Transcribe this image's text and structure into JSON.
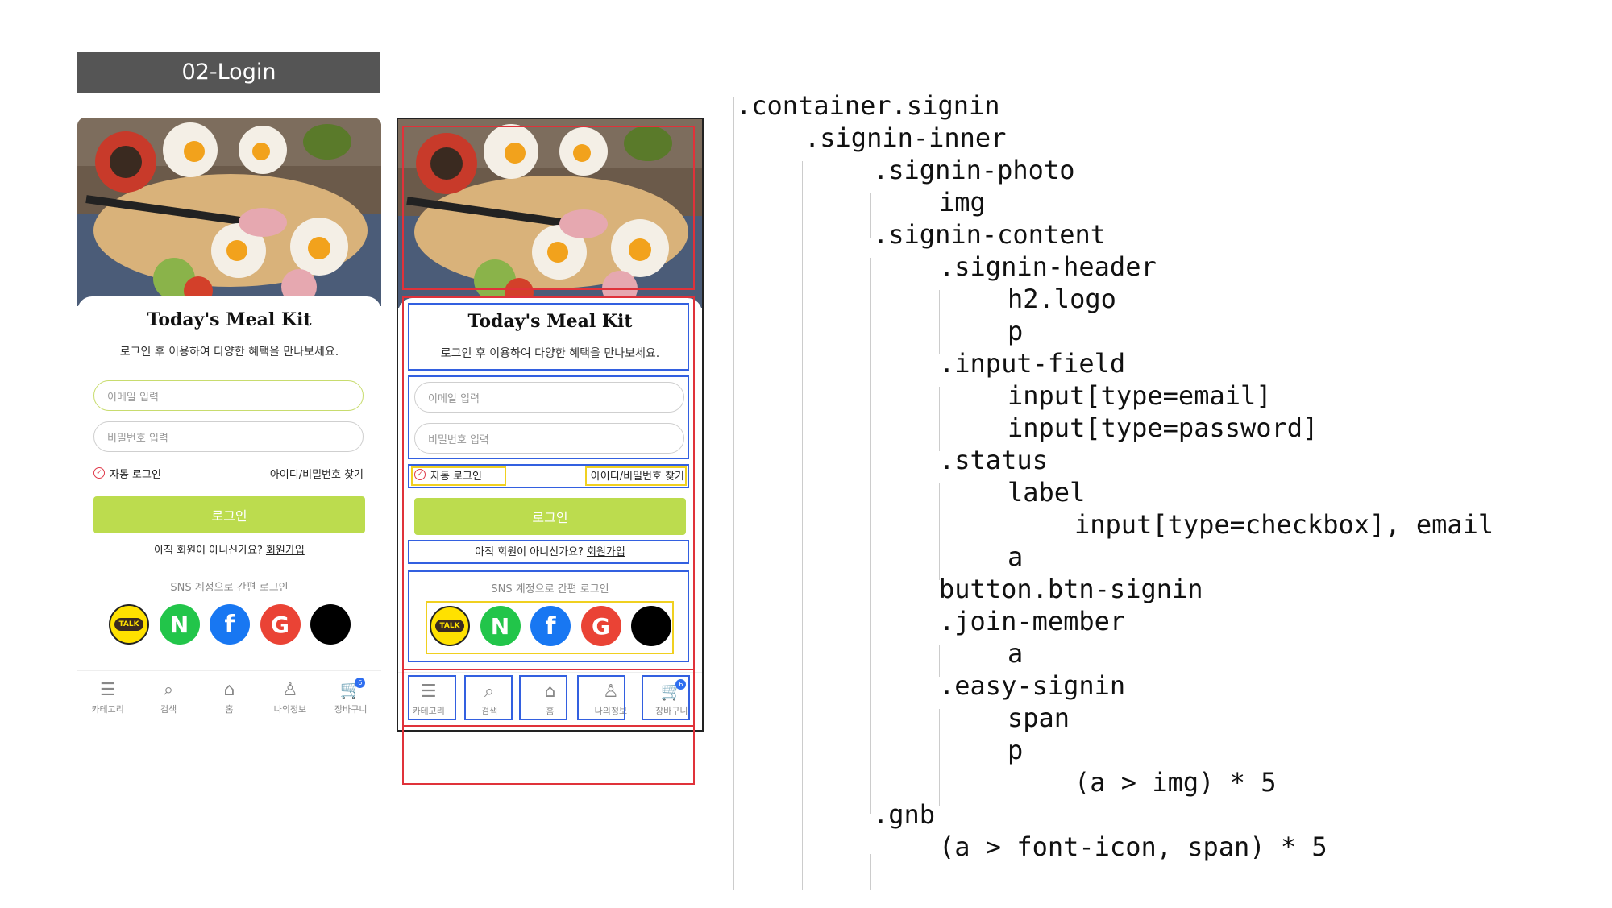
{
  "slide_title": "02-Login",
  "app": {
    "logo": "Today's Meal Kit",
    "tagline": "로그인 후 이용하여 다양한 혜택을 만나보세요.",
    "email_placeholder": "이메일 입력",
    "password_placeholder": "비밀번호 입력",
    "auto_login": "자동 로그인",
    "find_account": "아이디/비밀번호 찾기",
    "signin_button": "로그인",
    "join_text": "아직 회원이 아니신가요?",
    "join_link": "회원가입",
    "sns_title": "SNS 계정으로 간편 로그인",
    "sns": [
      {
        "name": "kakao",
        "label": "TALK",
        "color": "#ffe100"
      },
      {
        "name": "naver",
        "label": "N",
        "color": "#22c54a"
      },
      {
        "name": "facebook",
        "label": "f",
        "color": "#1877f2"
      },
      {
        "name": "google",
        "label": "G",
        "color": "#ea4335"
      },
      {
        "name": "apple",
        "label": "",
        "color": "#000000"
      }
    ],
    "gnb": [
      {
        "label": "카테고리",
        "icon": "menu-icon"
      },
      {
        "label": "검색",
        "icon": "search-icon"
      },
      {
        "label": "홈",
        "icon": "home-icon"
      },
      {
        "label": "나의정보",
        "icon": "user-icon"
      },
      {
        "label": "장바구니",
        "icon": "cart-icon",
        "badge": "6"
      }
    ],
    "accent_color": "#bcdc4e"
  },
  "code_tree": [
    {
      "text": ".container.signin"
    },
    {
      "text": ".signin-inner"
    },
    {
      "text": ".signin-photo"
    },
    {
      "text": "img"
    },
    {
      "text": ".signin-content"
    },
    {
      "text": ".signin-header"
    },
    {
      "text": "h2.logo"
    },
    {
      "text": "p"
    },
    {
      "text": ".input-field"
    },
    {
      "text": "input[type=email]"
    },
    {
      "text": "input[type=password]"
    },
    {
      "text": ".status"
    },
    {
      "text": "label"
    },
    {
      "text": "input[type=checkbox], email"
    },
    {
      "text": "a"
    },
    {
      "text": "button.btn-signin"
    },
    {
      "text": ".join-member"
    },
    {
      "text": "a"
    },
    {
      "text": ".easy-signin"
    },
    {
      "text": "span"
    },
    {
      "text": "p"
    },
    {
      "text": "(a > img) * 5"
    },
    {
      "text": ".gnb"
    },
    {
      "text": "(a > font-icon, span) * 5"
    }
  ]
}
